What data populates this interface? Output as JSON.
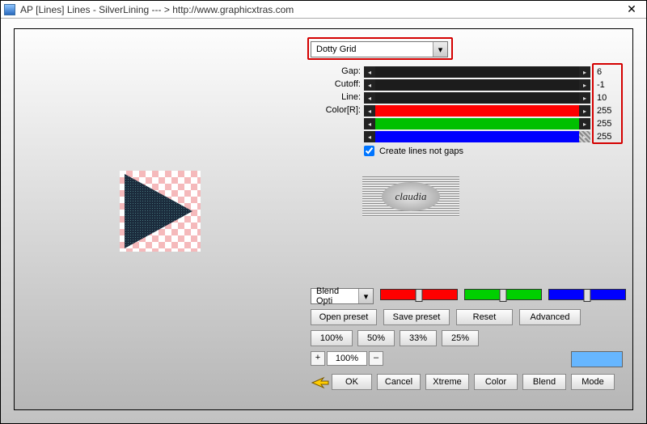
{
  "window": {
    "title": "AP [Lines]  Lines - SilverLining    --- >  http://www.graphicxtras.com"
  },
  "dropdown": {
    "selected": "Dotty Grid"
  },
  "rows": {
    "gap": {
      "label": "Gap:",
      "value": "6"
    },
    "cutoff": {
      "label": "Cutoff:",
      "value": "-1"
    },
    "line": {
      "label": "Line:",
      "value": "10"
    },
    "r": {
      "label": "Color[R]:",
      "value": "255"
    },
    "g": {
      "label": "",
      "value": "255"
    },
    "b": {
      "label": "",
      "value": "255"
    }
  },
  "checkbox": {
    "label": "Create lines not gaps",
    "checked": true
  },
  "logo": {
    "text": "claudia"
  },
  "blendOptions": {
    "label": "Blend Opti"
  },
  "buttons": {
    "openPreset": "Open preset",
    "savePreset": "Save preset",
    "reset": "Reset",
    "advanced": "Advanced",
    "p100": "100%",
    "p50": "50%",
    "p33": "33%",
    "p25": "25%",
    "ok": "OK",
    "cancel": "Cancel",
    "xtreme": "Xtreme",
    "color": "Color",
    "blend": "Blend",
    "mode": "Mode"
  },
  "zoom": {
    "value": "100%",
    "plus": "+",
    "minus": "–"
  },
  "sliderColors": {
    "r": "#ff0000",
    "g": "#00d000",
    "b": "#0000ff"
  }
}
